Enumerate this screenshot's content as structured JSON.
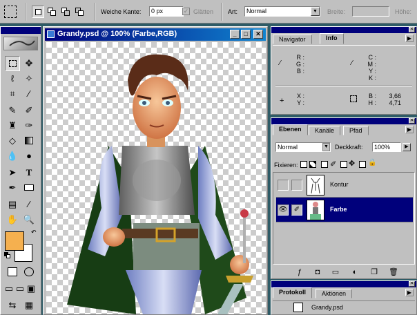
{
  "options_bar": {
    "weiche_kante_label": "Weiche Kante:",
    "weiche_kante_value": "0 px",
    "glaetten_label": "Glätten",
    "art_label": "Art:",
    "art_value": "Normal",
    "breite_label": "Breite:",
    "hoehe_label": "Höhe:"
  },
  "document": {
    "title": "Grandy.psd @ 100% (Farbe,RGB)"
  },
  "navigator_panel": {
    "tabs": [
      "Navigator",
      "Info"
    ],
    "active_tab": "Info",
    "rgb_labels": [
      "R :",
      "G :",
      "B :"
    ],
    "cmyk_labels": [
      "C :",
      "M :",
      "Y :",
      "K :"
    ],
    "xy_labels": [
      "X :",
      "Y :"
    ],
    "bh_labels": [
      "B :",
      "H :"
    ],
    "b_value": "3,66",
    "h_value": "4,71"
  },
  "layers_panel": {
    "tabs": [
      "Ebenen",
      "Kanäle",
      "Pfad"
    ],
    "active_tab": "Ebenen",
    "blend_mode": "Normal",
    "deckkraft_label": "Deckkraft:",
    "deckkraft_value": "100%",
    "fixieren_label": "Fixieren:",
    "layers": [
      {
        "name": "Kontur",
        "visible": false,
        "selected": false
      },
      {
        "name": "Farbe",
        "visible": true,
        "selected": true
      }
    ]
  },
  "history_panel": {
    "tabs": [
      "Protokoll",
      "Aktionen"
    ],
    "active_tab": "Protokoll",
    "snapshot_name": "Grandy.psd"
  },
  "colors": {
    "foreground": "#f5b04f",
    "background": "#ffffff",
    "selected_layer": "#00007b"
  }
}
